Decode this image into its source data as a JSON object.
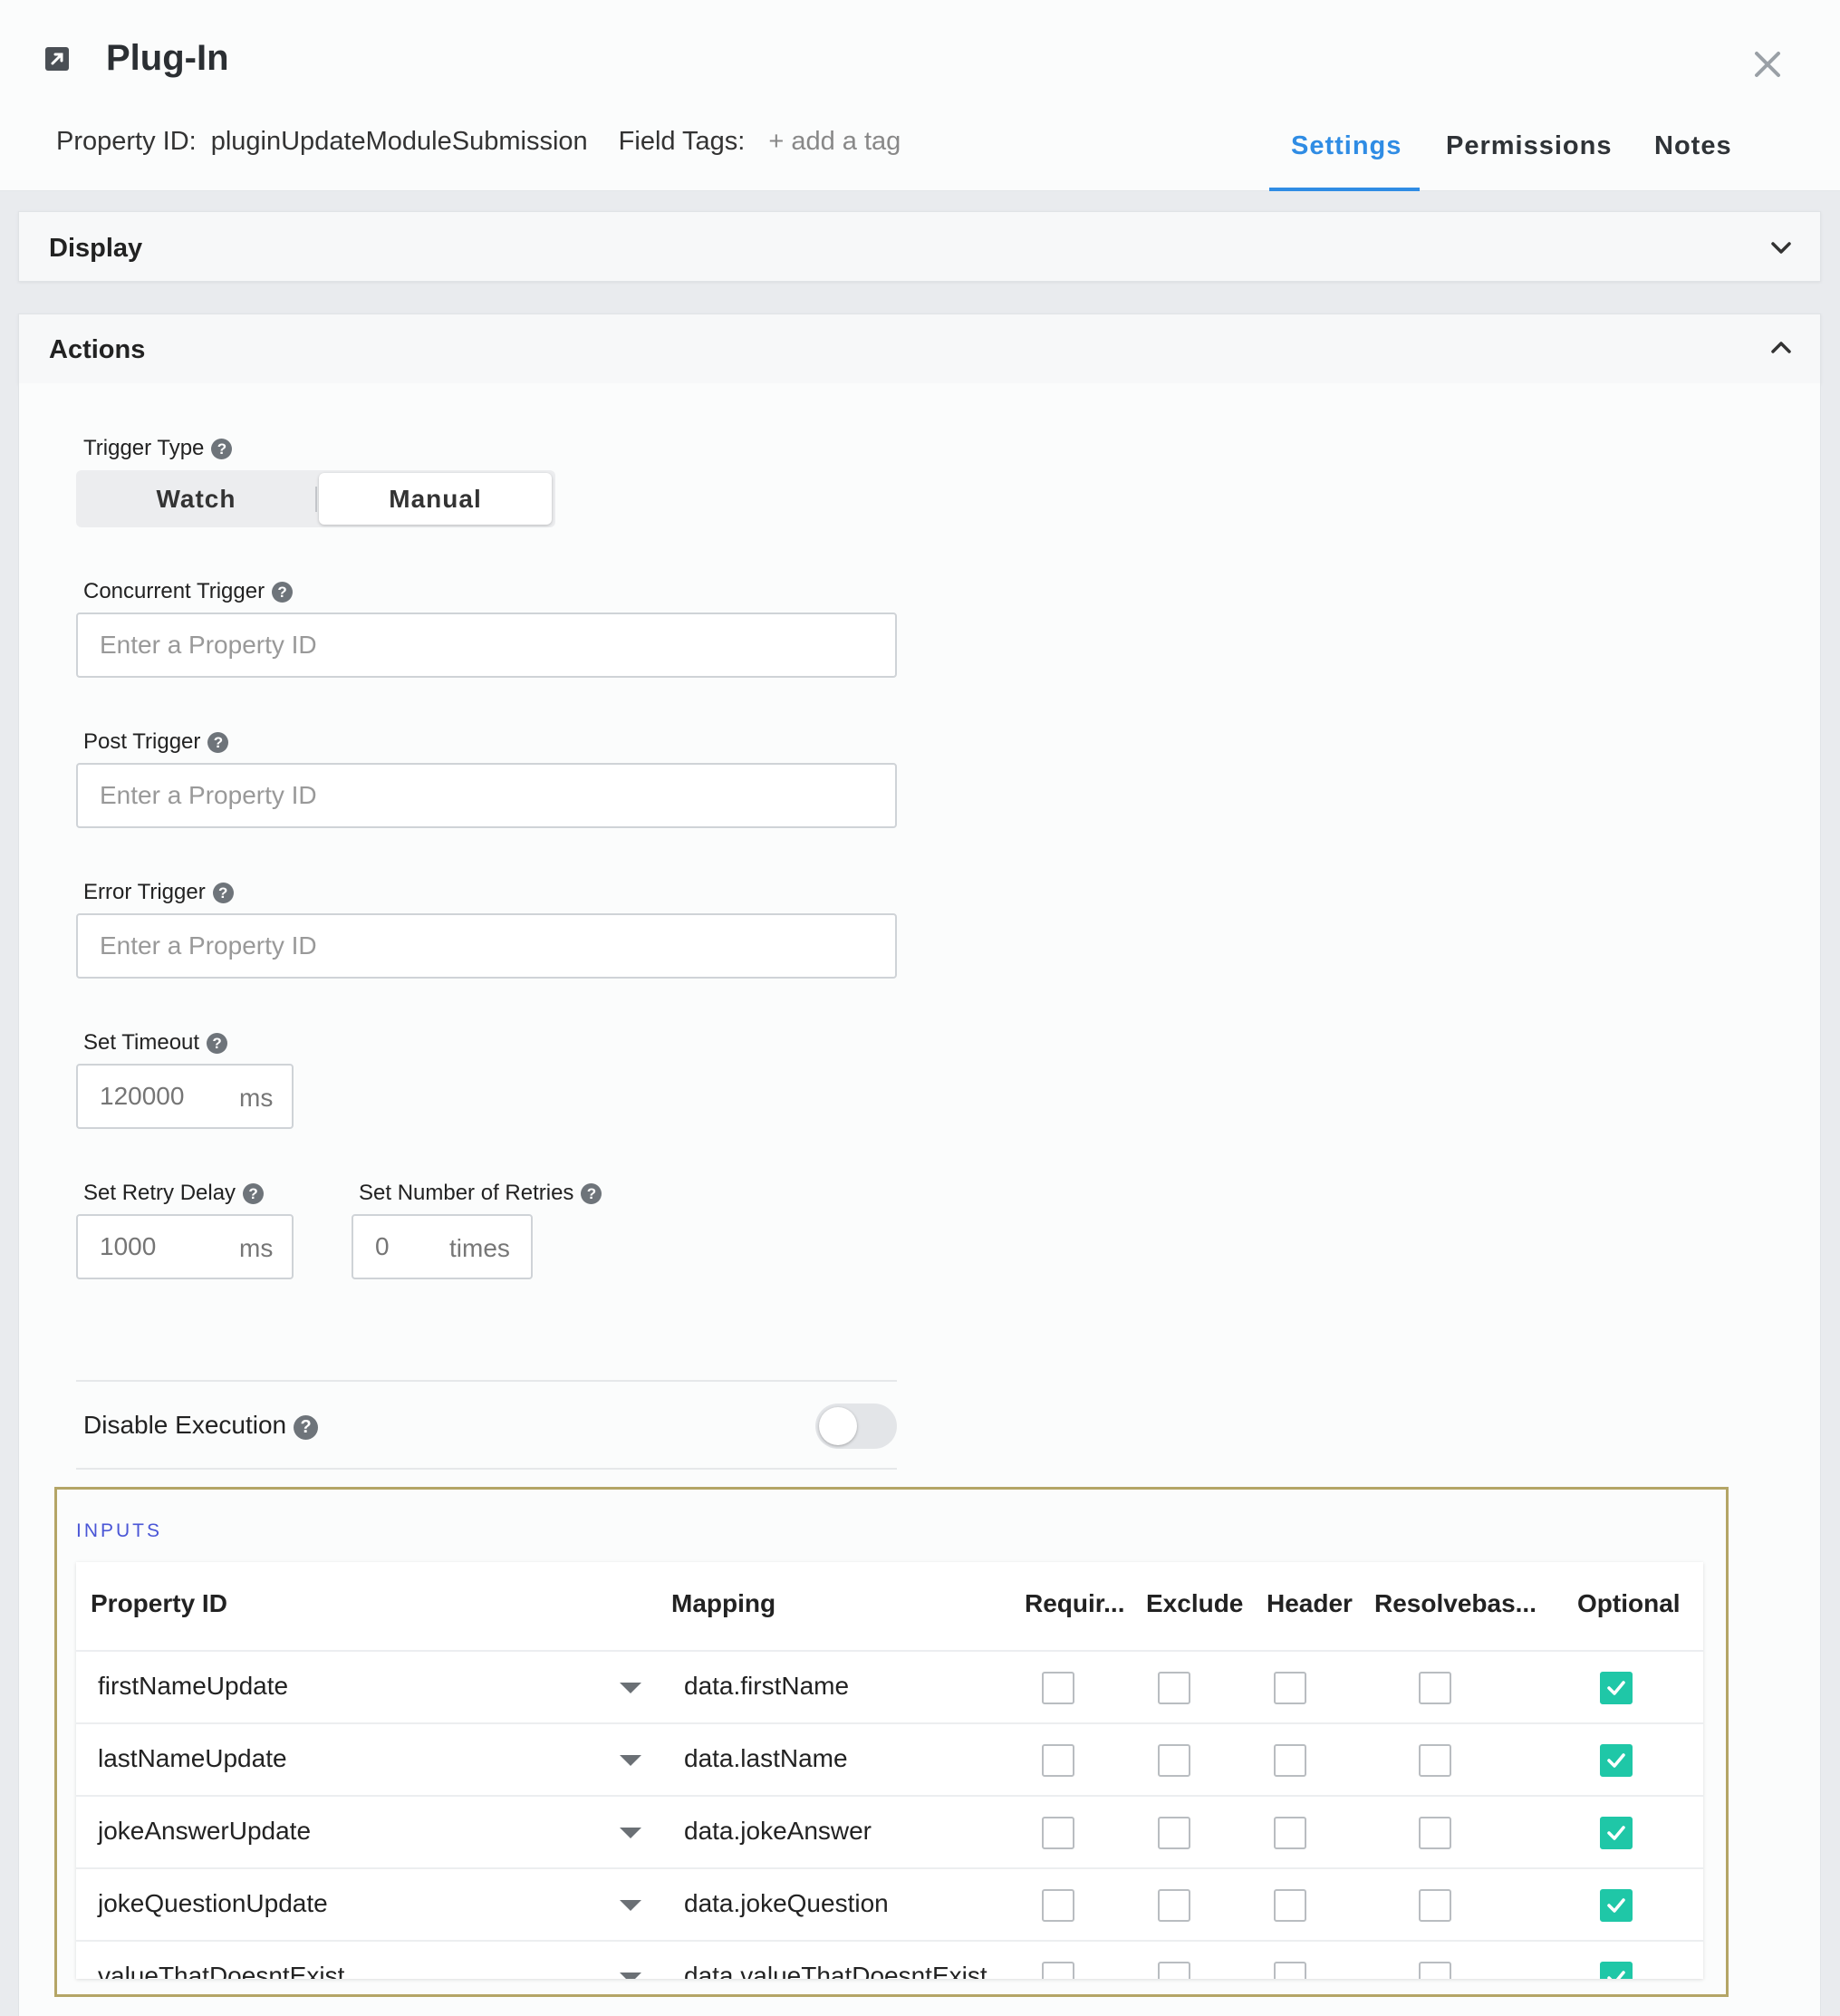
{
  "header": {
    "title": "Plug-In",
    "property_id_label": "Property ID:",
    "property_id_value": "pluginUpdateModuleSubmission",
    "field_tags_label": "Field Tags:",
    "add_tag": "+ add a tag"
  },
  "tabs": [
    {
      "label": "Settings",
      "active": true
    },
    {
      "label": "Permissions",
      "active": false
    },
    {
      "label": "Notes",
      "active": false
    }
  ],
  "sections": {
    "display": "Display",
    "actions": "Actions"
  },
  "actions": {
    "trigger_type_label": "Trigger Type",
    "trigger_options": [
      "Watch",
      "Manual"
    ],
    "trigger_selected": "Manual",
    "concurrent_trigger_label": "Concurrent Trigger",
    "post_trigger_label": "Post Trigger",
    "error_trigger_label": "Error Trigger",
    "property_placeholder": "Enter a Property ID",
    "set_timeout_label": "Set Timeout",
    "timeout_placeholder": "120000",
    "timeout_unit": "ms",
    "retry_delay_label": "Set Retry Delay",
    "retry_delay_placeholder": "1000",
    "retry_delay_unit": "ms",
    "retries_label": "Set Number of Retries",
    "retries_placeholder": "0",
    "retries_unit": "times",
    "disable_execution_label": "Disable Execution",
    "disable_execution_on": false
  },
  "inputs": {
    "title": "INPUTS",
    "columns": [
      "Property ID",
      "Mapping",
      "Requir...",
      "Exclude",
      "Header",
      "Resolvebas...",
      "Optional"
    ],
    "rows": [
      {
        "property_id": "firstNameUpdate",
        "mapping": "data.firstName",
        "required": false,
        "exclude": false,
        "header": false,
        "resolvebase": false,
        "optional": true
      },
      {
        "property_id": "lastNameUpdate",
        "mapping": "data.lastName",
        "required": false,
        "exclude": false,
        "header": false,
        "resolvebase": false,
        "optional": true
      },
      {
        "property_id": "jokeAnswerUpdate",
        "mapping": "data.jokeAnswer",
        "required": false,
        "exclude": false,
        "header": false,
        "resolvebase": false,
        "optional": true
      },
      {
        "property_id": "jokeQuestionUpdate",
        "mapping": "data.jokeQuestion",
        "required": false,
        "exclude": false,
        "header": false,
        "resolvebase": false,
        "optional": true
      },
      {
        "property_id": "valueThatDoesntExist",
        "mapping": "data.valueThatDoesntExist",
        "required": false,
        "exclude": false,
        "header": false,
        "resolvebase": false,
        "optional": true
      }
    ]
  },
  "colors": {
    "accent": "#2f8ce4",
    "checkbox_checked": "#1fc7a7",
    "inputs_border": "#b4a566",
    "inputs_title": "#4a56d6"
  },
  "icons": {
    "header": "external-link-icon",
    "close": "close-icon",
    "display_toggle": "chevron-down-icon",
    "actions_toggle": "chevron-up-icon",
    "help": "help-circle-icon",
    "dropdown": "caret-down-icon",
    "check": "check-icon"
  }
}
